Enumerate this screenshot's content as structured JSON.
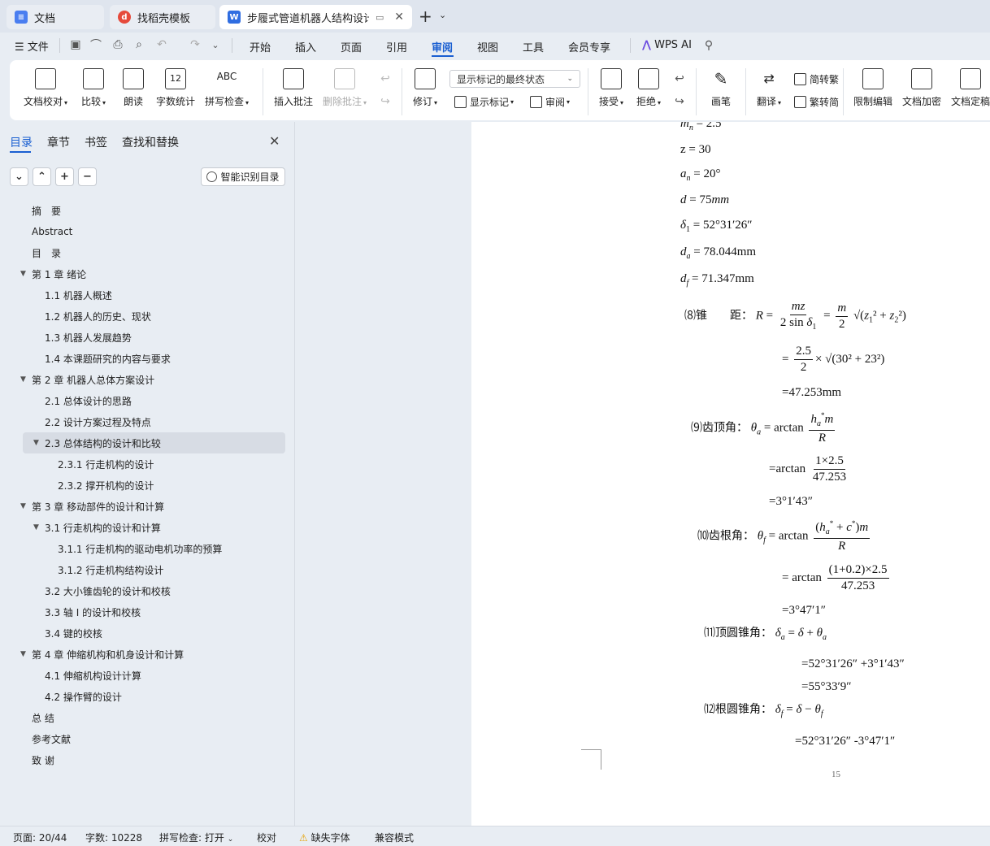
{
  "tabs": [
    {
      "label": "文档",
      "icon": "docs-icon",
      "color": "#4a7ef0"
    },
    {
      "label": "找稻壳模板",
      "icon": "docer-icon",
      "color": "#e64a3b"
    },
    {
      "label": "步履式管道机器人结构设计 说",
      "icon": "word-icon",
      "color": "#2f6de1"
    }
  ],
  "menu": {
    "file": "文件",
    "items": [
      "开始",
      "插入",
      "页面",
      "引用",
      "审阅",
      "视图",
      "工具",
      "会员专享"
    ],
    "active": "审阅",
    "wps_ai": "WPS AI"
  },
  "ribbon": {
    "proofread": "文档校对",
    "compare": "比较",
    "read_aloud": "朗读",
    "word_count": "字数统计",
    "spell_check": "拼写检查",
    "spell_icon_text": "ABC",
    "word_count_icon_text": "12",
    "insert_comment": "插入批注",
    "delete_comment": "删除批注",
    "track_changes": "修订",
    "markup_state": "显示标记的最终状态",
    "show_markup": "显示标记",
    "review": "审阅",
    "accept": "接受",
    "reject": "拒绝",
    "pen": "画笔",
    "translate": "翻译",
    "to_traditional": "简转繁",
    "to_simplified": "繁转简",
    "restrict_edit": "限制编辑",
    "encrypt": "文档加密",
    "finalize": "文档定稿"
  },
  "nav": {
    "tabs": [
      "目录",
      "章节",
      "书签",
      "查找和替换"
    ],
    "active_tab": "目录",
    "smart_toc": "智能识别目录",
    "items": [
      {
        "label": "摘　要",
        "level": 1,
        "caret": false
      },
      {
        "label": "Abstract",
        "level": 1,
        "caret": false
      },
      {
        "label": "目　录",
        "level": 1,
        "caret": false
      },
      {
        "label": "第 1 章  绪论",
        "level": 1,
        "caret": true
      },
      {
        "label": "1.1  机器人概述",
        "level": 2,
        "caret": false
      },
      {
        "label": "1.2  机器人的历史、现状",
        "level": 2,
        "caret": false
      },
      {
        "label": "1.3 机器人发展趋势",
        "level": 2,
        "caret": false
      },
      {
        "label": "1.4  本课题研究的内容与要求",
        "level": 2,
        "caret": false
      },
      {
        "label": "第 2 章  机器人总体方案设计",
        "level": 1,
        "caret": true
      },
      {
        "label": "2.1 总体设计的思路",
        "level": 2,
        "caret": false
      },
      {
        "label": "2.2  设计方案过程及特点",
        "level": 2,
        "caret": false
      },
      {
        "label": "2.3  总体结构的设计和比较",
        "level": 2,
        "caret": true,
        "selected": true
      },
      {
        "label": "2.3.1  行走机构的设计",
        "level": 3,
        "caret": false
      },
      {
        "label": "2.3.2  撑开机构的设计",
        "level": 3,
        "caret": false
      },
      {
        "label": "第 3 章  移动部件的设计和计算",
        "level": 1,
        "caret": true
      },
      {
        "label": "3.1  行走机构的设计和计算",
        "level": 2,
        "caret": true
      },
      {
        "label": "3.1.1  行走机构的驱动电机功率的预算",
        "level": 3,
        "caret": false
      },
      {
        "label": "3.1.2  行走机构结构设计",
        "level": 3,
        "caret": false
      },
      {
        "label": "3.2 大小锥齿轮的设计和校核",
        "level": 2,
        "caret": false
      },
      {
        "label": "3.3  轴 I 的设计和校核",
        "level": 2,
        "caret": false
      },
      {
        "label": "3.4  键的校核",
        "level": 2,
        "caret": false
      },
      {
        "label": "第 4 章  伸缩机构和机身设计和计算",
        "level": 1,
        "caret": true
      },
      {
        "label": "4.1  伸缩机构设计计算",
        "level": 2,
        "caret": false
      },
      {
        "label": "4.2  操作臂的设计",
        "level": 2,
        "caret": false
      },
      {
        "label": "总 结",
        "level": 1,
        "caret": false
      },
      {
        "label": "参考文献",
        "level": 1,
        "caret": false
      },
      {
        "label": "致 谢",
        "level": 1,
        "caret": false
      }
    ]
  },
  "doc": {
    "params": {
      "mn": "= 2.5",
      "z": "z = 30",
      "an": "= 20°",
      "d": "= 75",
      "d_unit": "mm",
      "delta1": "= 52°31′26″",
      "da": "= 78.044mm",
      "df": "= 71.347mm"
    },
    "cone_label": "⑻锥　　距：",
    "cone_step2_num": "2.5",
    "cone_step2_den": "2",
    "cone_step2_rest": "× √(30² + 23²)",
    "cone_result": "=47.253mm",
    "tip_angle_label": "⑼齿顶角：",
    "tip_step2_num": "1×2.5",
    "tip_step2_den": "47.253",
    "tip_result": "=3°1′43″",
    "root_angle_label": "⑽齿根角：",
    "root_step2_num": "(1+0.2)×2.5",
    "root_step2_den": "47.253",
    "root_result": "=3°47′1″",
    "tip_cone_label": "⑾顶圆锥角：",
    "tip_cone_step": "=52°31′26″ +3°1′43″",
    "tip_cone_result": "=55°33′9″",
    "root_cone_label": "⑿根圆锥角：",
    "root_cone_step": "=52°31′26″ -3°47′1″",
    "page_number": "15"
  },
  "status": {
    "page": "页面: 20/44",
    "words": "字数: 10228",
    "spell": "拼写检查: 打开",
    "proof": "校对",
    "missing_font": "缺失字体",
    "compat": "兼容模式"
  }
}
